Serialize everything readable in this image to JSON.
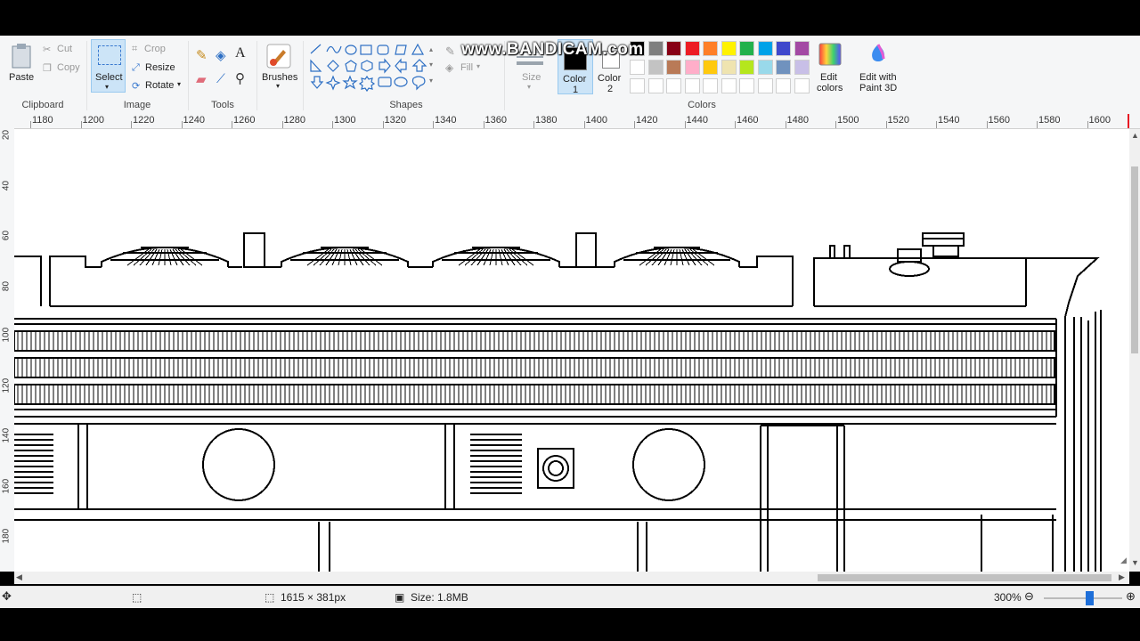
{
  "ribbon": {
    "clipboard": {
      "paste": "Paste",
      "cut": "Cut",
      "copy": "Copy",
      "group": "Clipboard"
    },
    "image": {
      "select": "Select",
      "crop": "Crop",
      "resize": "Resize",
      "rotate": "Rotate",
      "group": "Image"
    },
    "tools": {
      "group": "Tools"
    },
    "brushes": {
      "label": "Brushes"
    },
    "shapes": {
      "group": "Shapes",
      "outline": "",
      "fill": "Fill"
    },
    "size": {
      "label": "Size"
    },
    "color1": {
      "label1": "Color",
      "label2": "1",
      "value": "#000000"
    },
    "color2": {
      "label1": "Color",
      "label2": "2",
      "value": "#ffffff"
    },
    "colors": {
      "group": "Colors",
      "palette_row1": [
        "#000000",
        "#7f7f7f",
        "#880015",
        "#ed1c24",
        "#ff7f27",
        "#fff200",
        "#22b14c",
        "#00a2e8",
        "#3f48cc",
        "#a349a4"
      ],
      "palette_row2": [
        "#ffffff",
        "#c3c3c3",
        "#b97a57",
        "#ffaec9",
        "#ffc90e",
        "#efe4b0",
        "#b5e61d",
        "#99d9ea",
        "#7092be",
        "#c8bfe7"
      ]
    },
    "edit_colors": {
      "line1": "Edit",
      "line2": "colors"
    },
    "paint3d": {
      "line1": "Edit with",
      "line2": "Paint 3D"
    }
  },
  "watermark": "www.BANDICAM.com",
  "hruler": [
    "1180",
    "1200",
    "1220",
    "1240",
    "1260",
    "1280",
    "1300",
    "1320",
    "1340",
    "1360",
    "1380",
    "1400",
    "1420",
    "1440",
    "1460",
    "1480",
    "1500",
    "1520",
    "1540",
    "1560",
    "1580",
    "1600"
  ],
  "vruler": [
    "20",
    "40",
    "60",
    "80",
    "100",
    "120",
    "140",
    "160",
    "180"
  ],
  "status": {
    "dimensions": "1615 × 381px",
    "size": "Size: 1.8MB",
    "zoom": "300%"
  }
}
